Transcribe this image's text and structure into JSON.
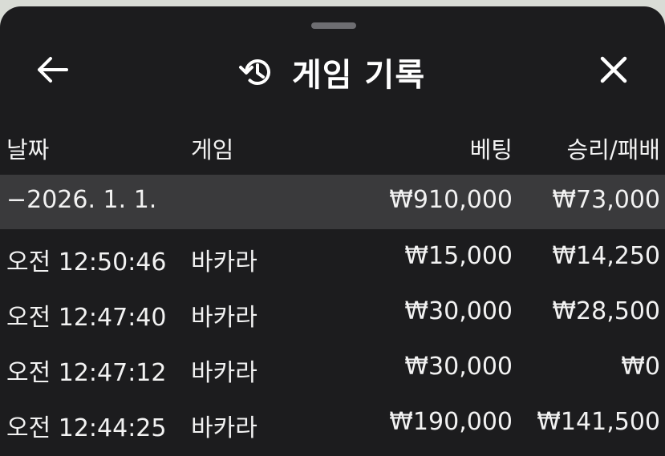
{
  "header": {
    "title": "게임 기록",
    "back_icon": "arrow-left-icon",
    "history_icon": "history-icon",
    "close_icon": "close-icon"
  },
  "columns": {
    "date": "날짜",
    "game": "게임",
    "bet": "베팅",
    "result": "승리/패배"
  },
  "group": {
    "date": "−2026. 1. 1.",
    "bet": "₩910,000",
    "result": "₩73,000"
  },
  "rows": [
    {
      "time": "오전 12:50:46",
      "game": "바카라",
      "bet": "₩15,000",
      "result": "₩14,250"
    },
    {
      "time": "오전 12:47:40",
      "game": "바카라",
      "bet": "₩30,000",
      "result": "₩28,500"
    },
    {
      "time": "오전 12:47:12",
      "game": "바카라",
      "bet": "₩30,000",
      "result": "₩0"
    },
    {
      "time": "오전 12:44:25",
      "game": "바카라",
      "bet": "₩190,000",
      "result": "₩141,500"
    }
  ],
  "colors": {
    "sheet_bg": "#1c1c1e",
    "group_bg": "#3a3a3c",
    "text": "#f2f2f2"
  }
}
